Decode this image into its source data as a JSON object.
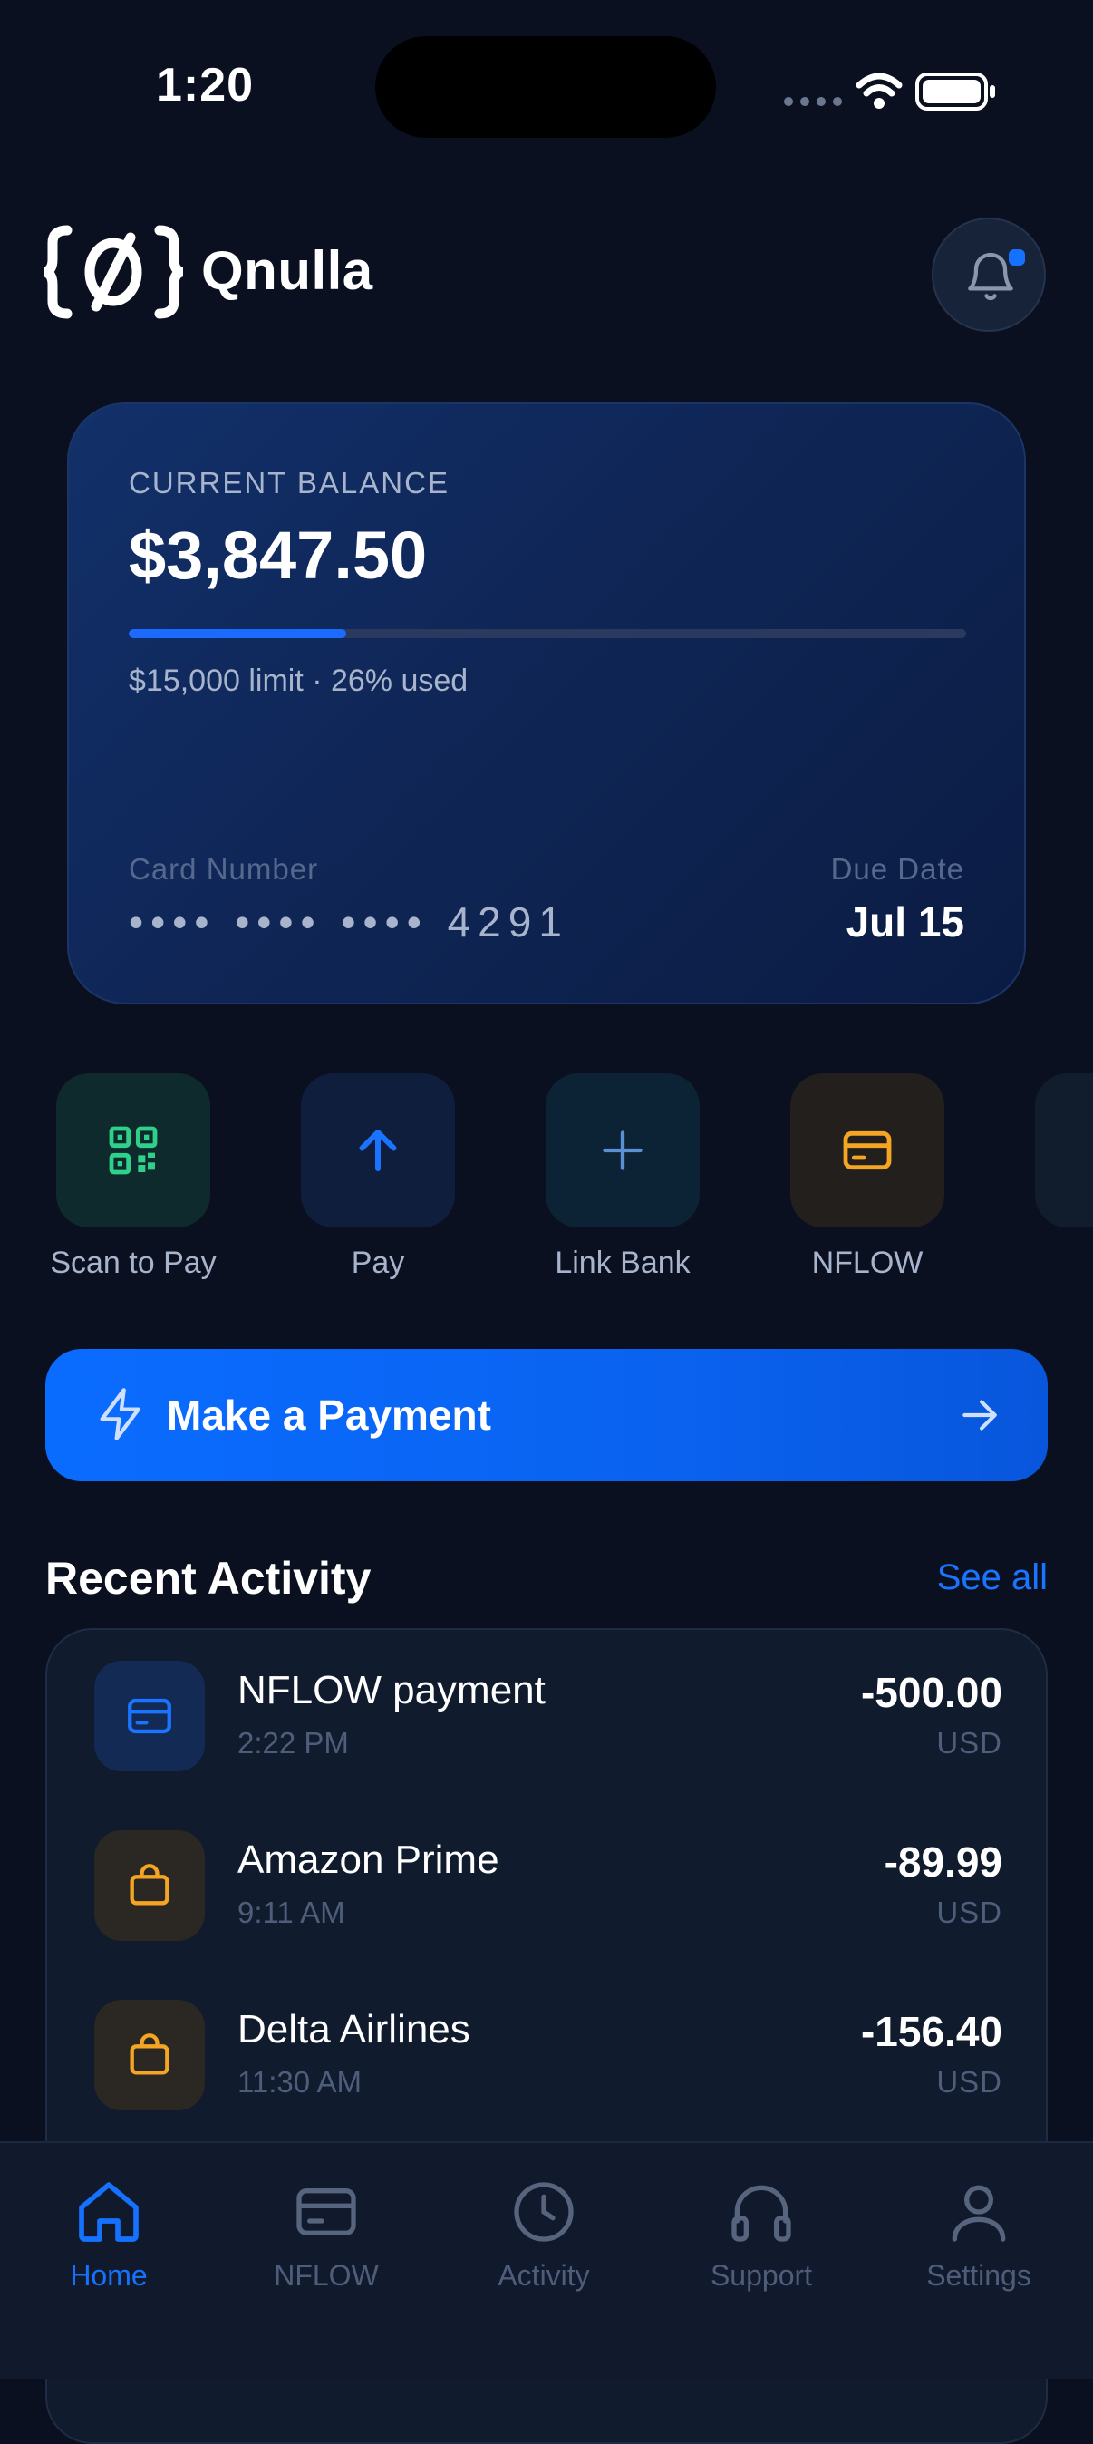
{
  "status_bar": {
    "time": "1:20"
  },
  "header": {
    "brand": "Qnulla"
  },
  "balance_card": {
    "label": "CURRENT BALANCE",
    "amount": "$3,847.50",
    "limit_text": "$15,000 limit · 26% used",
    "used_fraction": 0.26,
    "card_number_label": "Card Number",
    "card_number": "•••• •••• •••• 4291",
    "due_date_label": "Due Date",
    "due_date": "Jul 15"
  },
  "quick_actions": [
    {
      "label": "Scan to Pay",
      "icon": "qr-code-icon"
    },
    {
      "label": "Pay",
      "icon": "arrow-up-icon"
    },
    {
      "label": "Link Bank",
      "icon": "plus-icon"
    },
    {
      "label": "NFLOW",
      "icon": "credit-card-icon"
    }
  ],
  "make_payment": {
    "label": "Make a Payment"
  },
  "recent_activity": {
    "title": "Recent Activity",
    "see_all": "See all",
    "items": [
      {
        "name": "NFLOW payment",
        "time": "2:22 PM",
        "amount": "-500.00",
        "currency": "USD",
        "icon": "credit-card-icon"
      },
      {
        "name": "Amazon Prime",
        "time": "9:11 AM",
        "amount": "-89.99",
        "currency": "USD",
        "icon": "shopping-bag-icon"
      },
      {
        "name": "Delta Airlines",
        "time": "11:30 AM",
        "amount": "-156.40",
        "currency": "USD",
        "icon": "shopping-bag-icon"
      }
    ]
  },
  "tab_bar": [
    {
      "label": "Home",
      "icon": "home-icon",
      "active": true
    },
    {
      "label": "NFLOW",
      "icon": "credit-card-icon",
      "active": false
    },
    {
      "label": "Activity",
      "icon": "clock-icon",
      "active": false
    },
    {
      "label": "Support",
      "icon": "headphones-icon",
      "active": false
    },
    {
      "label": "Settings",
      "icon": "user-icon",
      "active": false
    }
  ],
  "colors": {
    "background": "#0a1020",
    "accent": "#1572ff",
    "green": "#2fd08a",
    "orange": "#f5a524"
  }
}
